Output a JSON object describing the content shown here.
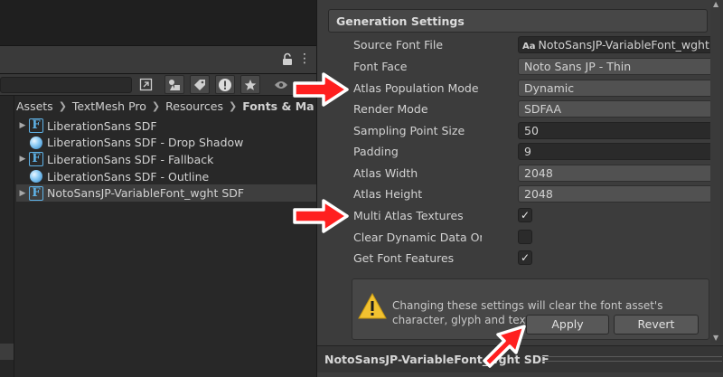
{
  "project": {
    "breadcrumb": [
      "Assets",
      "TextMesh Pro",
      "Resources",
      "Fonts & Ma"
    ],
    "files": [
      {
        "name": "LiberationSans SDF",
        "icon": "font-asset-icon",
        "expandable": true,
        "selected": false
      },
      {
        "name": "LiberationSans SDF - Drop Shadow",
        "icon": "material-icon",
        "expandable": false,
        "selected": false
      },
      {
        "name": "LiberationSans SDF - Fallback",
        "icon": "font-asset-icon",
        "expandable": true,
        "selected": false
      },
      {
        "name": "LiberationSans SDF - Outline",
        "icon": "material-icon",
        "expandable": false,
        "selected": false
      },
      {
        "name": "NotoSansJP-VariableFont_wght SDF",
        "icon": "font-asset-icon",
        "expandable": true,
        "selected": true
      }
    ],
    "font_icon_glyph": "F",
    "menu_glyph": "⋮"
  },
  "inspector": {
    "section_title": "Generation Settings",
    "properties": {
      "source_font_file": {
        "label": "Source Font File",
        "value": "NotoSansJP-VariableFont_wght",
        "type_icon": "Aa"
      },
      "font_face": {
        "label": "Font Face",
        "value": "Noto Sans JP - Thin"
      },
      "atlas_population_mode": {
        "label": "Atlas Population Mode",
        "value": "Dynamic"
      },
      "render_mode": {
        "label": "Render Mode",
        "value": "SDFAA"
      },
      "sampling_point_size": {
        "label": "Sampling Point Size",
        "value": "50"
      },
      "padding": {
        "label": "Padding",
        "value": "9"
      },
      "atlas_width": {
        "label": "Atlas Width",
        "value": "2048"
      },
      "atlas_height": {
        "label": "Atlas Height",
        "value": "2048"
      },
      "multi_atlas_textures": {
        "label": "Multi Atlas Textures",
        "checked": true
      },
      "clear_dynamic_data": {
        "label": "Clear Dynamic Data On",
        "checked": false
      },
      "get_font_features": {
        "label": "Get Font Features",
        "checked": true
      }
    },
    "warning": "Changing these settings will clear the font asset's character, glyph and texture data.",
    "apply_label": "Apply",
    "revert_label": "Revert",
    "bottom_title": "NotoSansJP-VariableFont_wght SDF",
    "checkmark": "✓",
    "dropdown_arrow": "▼"
  },
  "colors": {
    "annotation_arrow": "#ff1f1f",
    "font_icon": "#5fb3e8",
    "warning_icon": "#f2c230"
  }
}
